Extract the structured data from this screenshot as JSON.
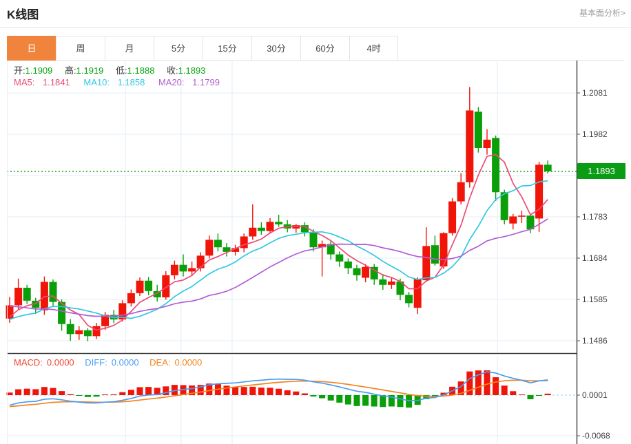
{
  "header": {
    "title": "K线图",
    "link_label": "基本面分析>"
  },
  "tabs": {
    "items": [
      "日",
      "周",
      "月",
      "5分",
      "15分",
      "30分",
      "60分",
      "4时"
    ],
    "selected": "日"
  },
  "ohlc": {
    "open_label": "开:",
    "open_value": "1.1909",
    "high_label": "高:",
    "high_value": "1.1919",
    "low_label": "低:",
    "low_value": "1.1888",
    "close_label": "收:",
    "close_value": "1.1893"
  },
  "ma_row": {
    "ma5_label": "MA5:",
    "ma5_value": "1.1841",
    "ma10_label": "MA10:",
    "ma10_value": "1.1858",
    "ma20_label": "MA20:",
    "ma20_value": "1.1799"
  },
  "macd_row": {
    "macd_label": "MACD:",
    "macd_value": "0.0000",
    "diff_label": "DIFF:",
    "diff_value": "0.0000",
    "dea_label": "DEA:",
    "dea_value": "0.0000"
  },
  "price_tag": "1.1893",
  "colors": {
    "up_red": "#f01508",
    "down_green": "#0a9f08",
    "ma5_pink": "#ee4a74",
    "ma10_cyan": "#33c7e3",
    "ma20_purple": "#b25dd4",
    "diff_blue": "#4a9cf0",
    "dea_orange": "#f5831d",
    "macd_text_red": "#f04433",
    "ohlc_value_green": "#0ca512",
    "current_price_line": "#21a32a",
    "price_tag_bg": "#0b9c16",
    "tab_selected_orange": "#f0843d",
    "grid_line": "#e5eef5",
    "vgrid_line": "#e2ecf4",
    "zero_dash_line": "#aed6ec",
    "axis_border": "#3a3a3a",
    "axis_text": "#444444"
  },
  "chart_data": {
    "type": "candlestick",
    "interval": "daily",
    "price_ticks": [
      1.2081,
      1.1982,
      1.1883,
      1.1783,
      1.1684,
      1.1585,
      1.1486
    ],
    "current_price": 1.1893,
    "macd_ticks": [
      0.0001,
      -0.0068
    ],
    "ma_periods": [
      5,
      10,
      20
    ],
    "candles_ohlc": [
      [
        1.154,
        1.1592,
        1.153,
        1.1572
      ],
      [
        1.1572,
        1.1636,
        1.156,
        1.1614
      ],
      [
        1.1614,
        1.1621,
        1.1575,
        1.1583
      ],
      [
        1.1583,
        1.159,
        1.1551,
        1.1566
      ],
      [
        1.156,
        1.1641,
        1.1549,
        1.1628
      ],
      [
        1.1628,
        1.1634,
        1.1568,
        1.158
      ],
      [
        1.158,
        1.1586,
        1.1511,
        1.1527
      ],
      [
        1.1527,
        1.1539,
        1.1487,
        1.1503
      ],
      [
        1.1503,
        1.1522,
        1.1489,
        1.1512
      ],
      [
        1.1512,
        1.1517,
        1.1486,
        1.1498
      ],
      [
        1.1498,
        1.153,
        1.1491,
        1.1522
      ],
      [
        1.1522,
        1.1556,
        1.1513,
        1.1549
      ],
      [
        1.1549,
        1.1561,
        1.1529,
        1.1538
      ],
      [
        1.1538,
        1.1584,
        1.1533,
        1.1577
      ],
      [
        1.1577,
        1.161,
        1.1569,
        1.1601
      ],
      [
        1.1601,
        1.1639,
        1.1594,
        1.1631
      ],
      [
        1.1631,
        1.164,
        1.1596,
        1.1606
      ],
      [
        1.1606,
        1.1621,
        1.1581,
        1.1591
      ],
      [
        1.1591,
        1.1654,
        1.1585,
        1.1644
      ],
      [
        1.1644,
        1.1679,
        1.1634,
        1.1669
      ],
      [
        1.1669,
        1.1694,
        1.1641,
        1.1653
      ],
      [
        1.1653,
        1.1677,
        1.1644,
        1.1661
      ],
      [
        1.1661,
        1.1699,
        1.1653,
        1.1691
      ],
      [
        1.1691,
        1.1739,
        1.1684,
        1.1729
      ],
      [
        1.1729,
        1.1744,
        1.1701,
        1.1711
      ],
      [
        1.1711,
        1.1721,
        1.1689,
        1.17
      ],
      [
        1.17,
        1.1717,
        1.1691,
        1.1709
      ],
      [
        1.1709,
        1.1744,
        1.1699,
        1.1737
      ],
      [
        1.1737,
        1.1814,
        1.1729,
        1.1758
      ],
      [
        1.1758,
        1.1771,
        1.1741,
        1.175
      ],
      [
        1.175,
        1.1781,
        1.1744,
        1.1772
      ],
      [
        1.1772,
        1.1789,
        1.176,
        1.1766
      ],
      [
        1.1766,
        1.1776,
        1.1747,
        1.1756
      ],
      [
        1.1756,
        1.1767,
        1.1746,
        1.1764
      ],
      [
        1.1764,
        1.1771,
        1.1737,
        1.1747
      ],
      [
        1.1747,
        1.1754,
        1.1701,
        1.1711
      ],
      [
        1.1711,
        1.1727,
        1.1641,
        1.1719
      ],
      [
        1.1719,
        1.1726,
        1.1681,
        1.1694
      ],
      [
        1.1694,
        1.1701,
        1.1664,
        1.1677
      ],
      [
        1.1677,
        1.1684,
        1.1647,
        1.1661
      ],
      [
        1.1661,
        1.1669,
        1.1631,
        1.1644
      ],
      [
        1.1638,
        1.1671,
        1.1627,
        1.1664
      ],
      [
        1.1664,
        1.1671,
        1.1621,
        1.1634
      ],
      [
        1.1634,
        1.1647,
        1.1609,
        1.1621
      ],
      [
        1.1621,
        1.1639,
        1.1611,
        1.1629
      ],
      [
        1.1629,
        1.1636,
        1.1584,
        1.1597
      ],
      [
        1.1597,
        1.1604,
        1.1567,
        1.1577
      ],
      [
        1.1566,
        1.1639,
        1.1551,
        1.1635
      ],
      [
        1.1632,
        1.1759,
        1.1628,
        1.1714
      ],
      [
        1.1716,
        1.1739,
        1.1667,
        1.1672
      ],
      [
        1.1665,
        1.1747,
        1.1659,
        1.1745
      ],
      [
        1.1745,
        1.1829,
        1.1739,
        1.1821
      ],
      [
        1.1821,
        1.1889,
        1.1814,
        1.1867
      ],
      [
        1.1867,
        1.2095,
        1.1854,
        1.2039
      ],
      [
        1.2036,
        1.2047,
        1.1938,
        1.1949
      ],
      [
        1.1949,
        1.1994,
        1.1933,
        1.1969
      ],
      [
        1.1973,
        1.1979,
        1.1822,
        1.1843
      ],
      [
        1.1843,
        1.1849,
        1.1766,
        1.1776
      ],
      [
        1.1768,
        1.1791,
        1.1754,
        1.1785
      ],
      [
        1.1785,
        1.1799,
        1.1769,
        1.1787
      ],
      [
        1.1787,
        1.1791,
        1.1745,
        1.1754
      ],
      [
        1.178,
        1.1916,
        1.1748,
        1.1909
      ],
      [
        1.1909,
        1.1919,
        1.1888,
        1.1893
      ]
    ]
  }
}
